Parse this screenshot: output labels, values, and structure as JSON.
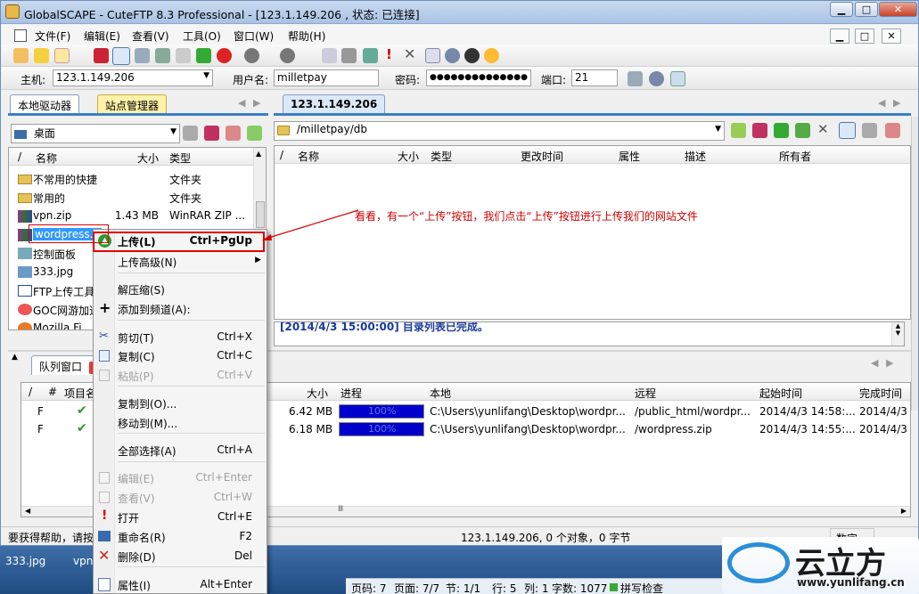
{
  "window": {
    "title": "GlobalSCAPE - CuteFTP 8.3 Professional - [123.1.149.206 , 状态: 已连接]",
    "min": "▁",
    "max": "□",
    "close": "✕"
  },
  "menu": [
    "文件(F)",
    "编辑(E)",
    "查看(V)",
    "工具(O)",
    "窗口(W)",
    "帮助(H)"
  ],
  "connect": {
    "host_label": "主机:",
    "host_value": "123.1.149.206",
    "user_label": "用户名:",
    "user_value": "milletpay",
    "pass_label": "密码:",
    "pass_value": "●●●●●●●●●●●●●●",
    "port_label": "端口:",
    "port_value": "21"
  },
  "left": {
    "tab_local": "本地驱动器",
    "tab_site": "站点管理器",
    "location": "桌面",
    "headers": {
      "sort": "/",
      "name": "名称",
      "size": "大小",
      "type": "类型"
    },
    "rows": [
      {
        "name": "不常用的快捷",
        "size": "",
        "type": "文件夹",
        "icon": "folder-icon"
      },
      {
        "name": "常用的",
        "size": "",
        "type": "文件夹",
        "icon": "folder-icon"
      },
      {
        "name": "vpn.zip",
        "size": "1.43 MB",
        "type": "WinRAR ZIP ...",
        "icon": "winrar-icon"
      },
      {
        "name": "wordpress...",
        "size": "",
        "type": "",
        "icon": "winrar-icon"
      },
      {
        "name": "控制面板",
        "size": "",
        "type": "",
        "icon": "control-panel-icon"
      },
      {
        "name": "333.jpg",
        "size": "",
        "type": "",
        "icon": "image-icon"
      },
      {
        "name": "FTP上传工具",
        "size": "",
        "type": "",
        "icon": "document-icon"
      },
      {
        "name": "GOC网游加速",
        "size": "",
        "type": "",
        "icon": "app-icon"
      },
      {
        "name": "Mozilla Fi...",
        "size": "",
        "type": "",
        "icon": "browser-icon"
      }
    ]
  },
  "right": {
    "tab": "123.1.149.206",
    "path": "/milletpay/db",
    "headers": {
      "sort": "/",
      "name": "名称",
      "size": "大小",
      "type": "类型",
      "modified": "更改时间",
      "attr": "属性",
      "desc": "描述",
      "owner": "所有者"
    },
    "log_partial": "[2014/4/3 15:00:00] 目录列表已完成。"
  },
  "queue": {
    "tab": "队列窗口",
    "headers": {
      "sort": "/",
      "num": "#",
      "item": "项目名",
      "size": "大小",
      "progress": "进程",
      "local": "本地",
      "remote": "远程",
      "start": "起始时间",
      "done": "完成时间"
    },
    "rows": [
      {
        "f": "F",
        "size": "6.42 MB",
        "progress": 1.0,
        "progress_text": "100%",
        "local": "C:\\Users\\yunlifang\\Desktop\\wordpr...",
        "remote": "/public_html/wordpr...",
        "start": "2014/4/3 14:58:...",
        "done": "2014/4/3"
      },
      {
        "f": "F",
        "size": "6.18 MB",
        "progress": 1.0,
        "progress_text": "100%",
        "local": "C:\\Users\\yunlifang\\Desktop\\wordpr...",
        "remote": "/wordpress.zip",
        "start": "2014/4/3 14:55:...",
        "done": "2014/4/3"
      }
    ]
  },
  "status": {
    "help": "要获得帮助，请按",
    "center": "123.1.149.206, 0 个对象，0 字节",
    "num": "数字"
  },
  "context_menu": {
    "items": [
      {
        "label": "上传(L)",
        "key": "Ctrl+PgUp",
        "icon": "upload-icon",
        "enabled": true,
        "bold": true
      },
      {
        "label": "上传高级(N)",
        "key": "",
        "icon": "",
        "enabled": true,
        "submenu": true
      },
      {
        "label": "解压缩(S)",
        "key": "",
        "icon": "",
        "enabled": true
      },
      {
        "label": "添加到频道(A):",
        "key": "",
        "icon": "plus-icon",
        "enabled": true
      },
      {
        "label": "剪切(T)",
        "key": "Ctrl+X",
        "icon": "scissors-icon",
        "enabled": true
      },
      {
        "label": "复制(C)",
        "key": "Ctrl+C",
        "icon": "copy-icon",
        "enabled": true
      },
      {
        "label": "粘贴(P)",
        "key": "Ctrl+V",
        "icon": "paste-icon",
        "enabled": false
      },
      {
        "label": "复制到(O)...",
        "key": "",
        "icon": "",
        "enabled": true
      },
      {
        "label": "移动到(M)...",
        "key": "",
        "icon": "",
        "enabled": true
      },
      {
        "label": "全部选择(A)",
        "key": "Ctrl+A",
        "icon": "",
        "enabled": true
      },
      {
        "label": "编辑(E)",
        "key": "Ctrl+Enter",
        "icon": "edit-icon",
        "enabled": false
      },
      {
        "label": "查看(V)",
        "key": "Ctrl+W",
        "icon": "view-icon",
        "enabled": false
      },
      {
        "label": "打开",
        "key": "Ctrl+E",
        "icon": "exclamation-icon",
        "enabled": true
      },
      {
        "label": "重命名(R)",
        "key": "F2",
        "icon": "rename-icon",
        "enabled": true
      },
      {
        "label": "删除(D)",
        "key": "Del",
        "icon": "delete-icon",
        "enabled": true
      },
      {
        "label": "属性(I)",
        "key": "Alt+Enter",
        "icon": "properties-icon",
        "enabled": true
      }
    ]
  },
  "annotation": "看看，有一个“上传”按钮，我们点击“上传”按钮进行上传我们的网站文件",
  "taskbar": {
    "item1": "333.jpg",
    "item2": "vpn"
  },
  "doc_status": {
    "page": "页码: 7",
    "pages": "页面: 7/7",
    "section": "节: 1/1",
    "line": "行: 5",
    "col": "列: 1",
    "words": "字数: 1077",
    "spell": "拼写检查"
  },
  "logo": {
    "name": "云立方",
    "url": "www.yunlifang.cn"
  },
  "colors": {
    "highlight": "#e00000",
    "progress": "#0000cc",
    "selection": "#3399ff"
  }
}
